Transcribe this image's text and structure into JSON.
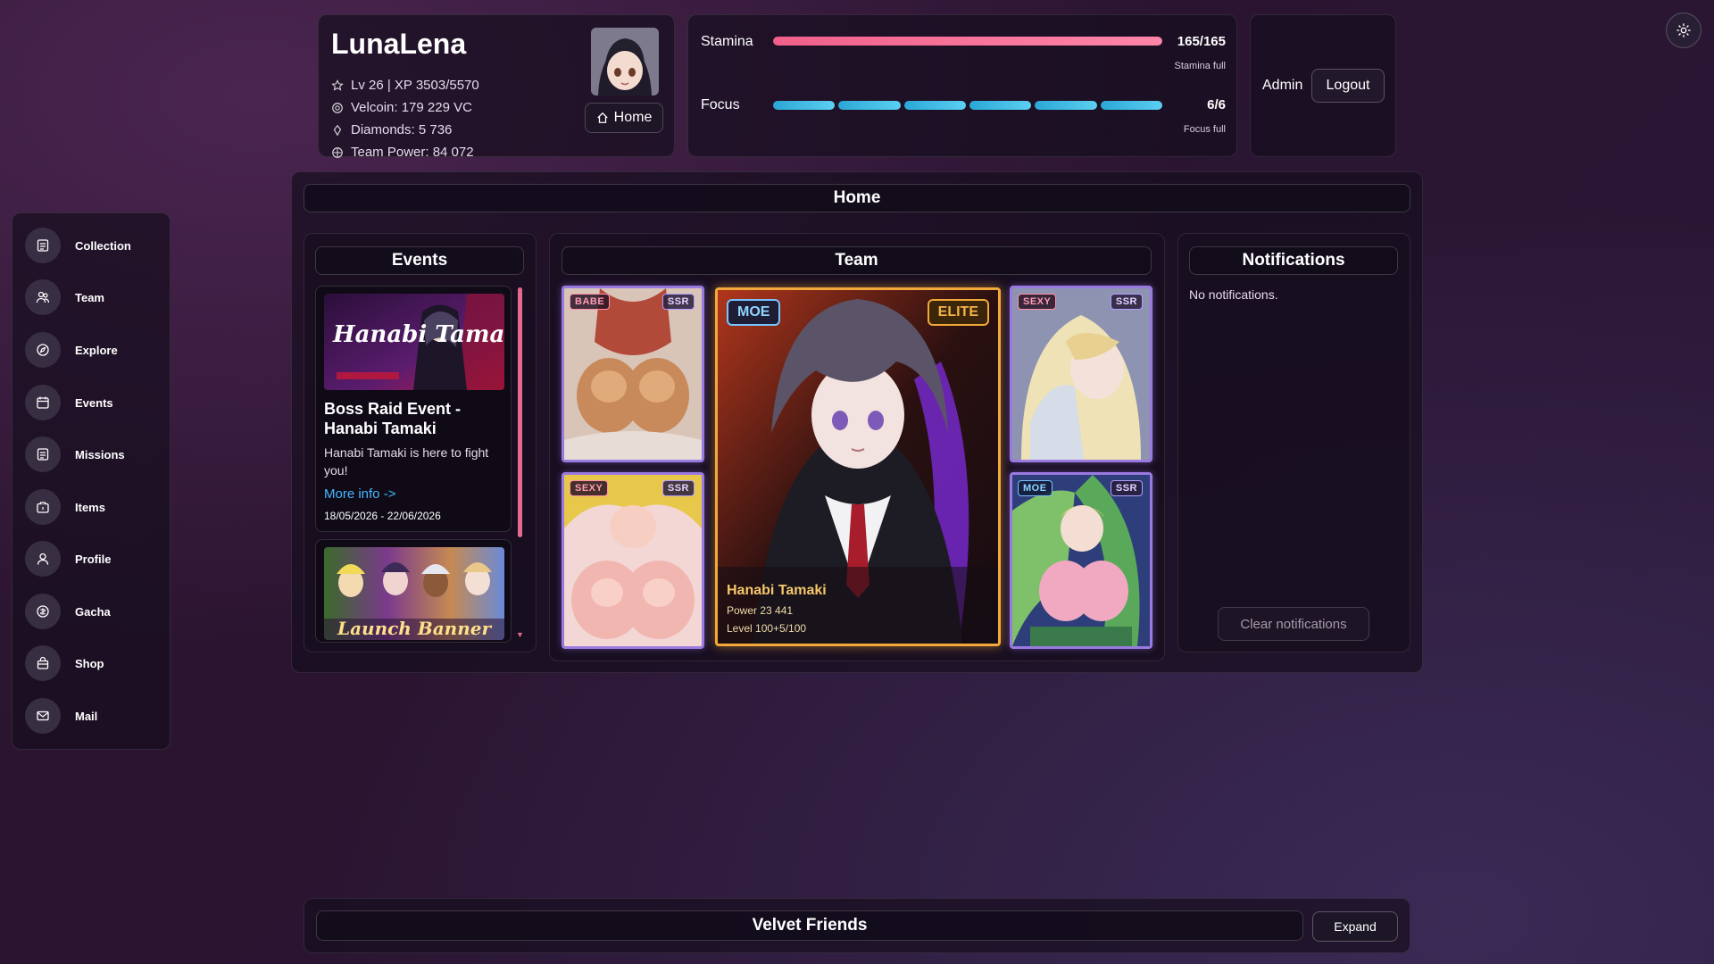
{
  "profile": {
    "name": "LunaLena",
    "level_xp": "Lv 26 | XP 3503/5570",
    "velcoin": "Velcoin: 179 229 VC",
    "diamonds": "Diamonds: 5 736",
    "team_power": "Team Power: 84 072",
    "home_button": "Home"
  },
  "resources": {
    "stamina": {
      "label": "Stamina",
      "value": "165/165",
      "status": "Stamina full",
      "fill_fraction": 1.0
    },
    "focus": {
      "label": "Focus",
      "value": "6/6",
      "status": "Focus full",
      "segments_filled": 6,
      "segments_total": 6
    }
  },
  "account": {
    "role": "Admin",
    "logout_button": "Logout"
  },
  "sidebar": {
    "items": [
      {
        "label": "Collection",
        "icon": "collection-icon"
      },
      {
        "label": "Team",
        "icon": "team-icon"
      },
      {
        "label": "Explore",
        "icon": "compass-icon"
      },
      {
        "label": "Events",
        "icon": "calendar-icon"
      },
      {
        "label": "Missions",
        "icon": "missions-icon"
      },
      {
        "label": "Items",
        "icon": "items-icon"
      },
      {
        "label": "Profile",
        "icon": "profile-icon"
      },
      {
        "label": "Gacha",
        "icon": "gacha-icon"
      },
      {
        "label": "Shop",
        "icon": "shop-icon"
      },
      {
        "label": "Mail",
        "icon": "mail-icon"
      }
    ]
  },
  "main": {
    "title": "Home",
    "events": {
      "title": "Events",
      "items": [
        {
          "banner_text": "Hanabi Tamaki",
          "title": "Boss Raid Event - Hanabi Tamaki",
          "description": "Hanabi Tamaki is here to fight you!",
          "link": "More info ->",
          "date_range": "18/05/2026 - 22/06/2026"
        },
        {
          "banner_text": "Launch Banner"
        }
      ]
    },
    "team": {
      "title": "Team",
      "featured": {
        "name": "Hanabi Tamaki",
        "power": "Power 23 441",
        "level": "Level 100+5/100",
        "type_tag": "MOE",
        "rank_tag": "ELITE"
      },
      "members": [
        {
          "type_tag": "BABE",
          "rarity_tag": "SSR"
        },
        {
          "type_tag": "SEXY",
          "rarity_tag": "SSR"
        },
        {
          "type_tag": "SEXY",
          "rarity_tag": "SSR"
        },
        {
          "type_tag": "MOE",
          "rarity_tag": "SSR"
        }
      ]
    },
    "notifications": {
      "title": "Notifications",
      "empty_text": "No notifications.",
      "clear_button": "Clear notifications"
    }
  },
  "friends": {
    "title": "Velvet Friends",
    "expand_button": "Expand"
  },
  "colors": {
    "stamina": "#f0608a",
    "focus": "#3fb8e4",
    "accent_gold": "#f2a83a",
    "accent_purple": "#9a7ae0",
    "link": "#44b8ff"
  }
}
